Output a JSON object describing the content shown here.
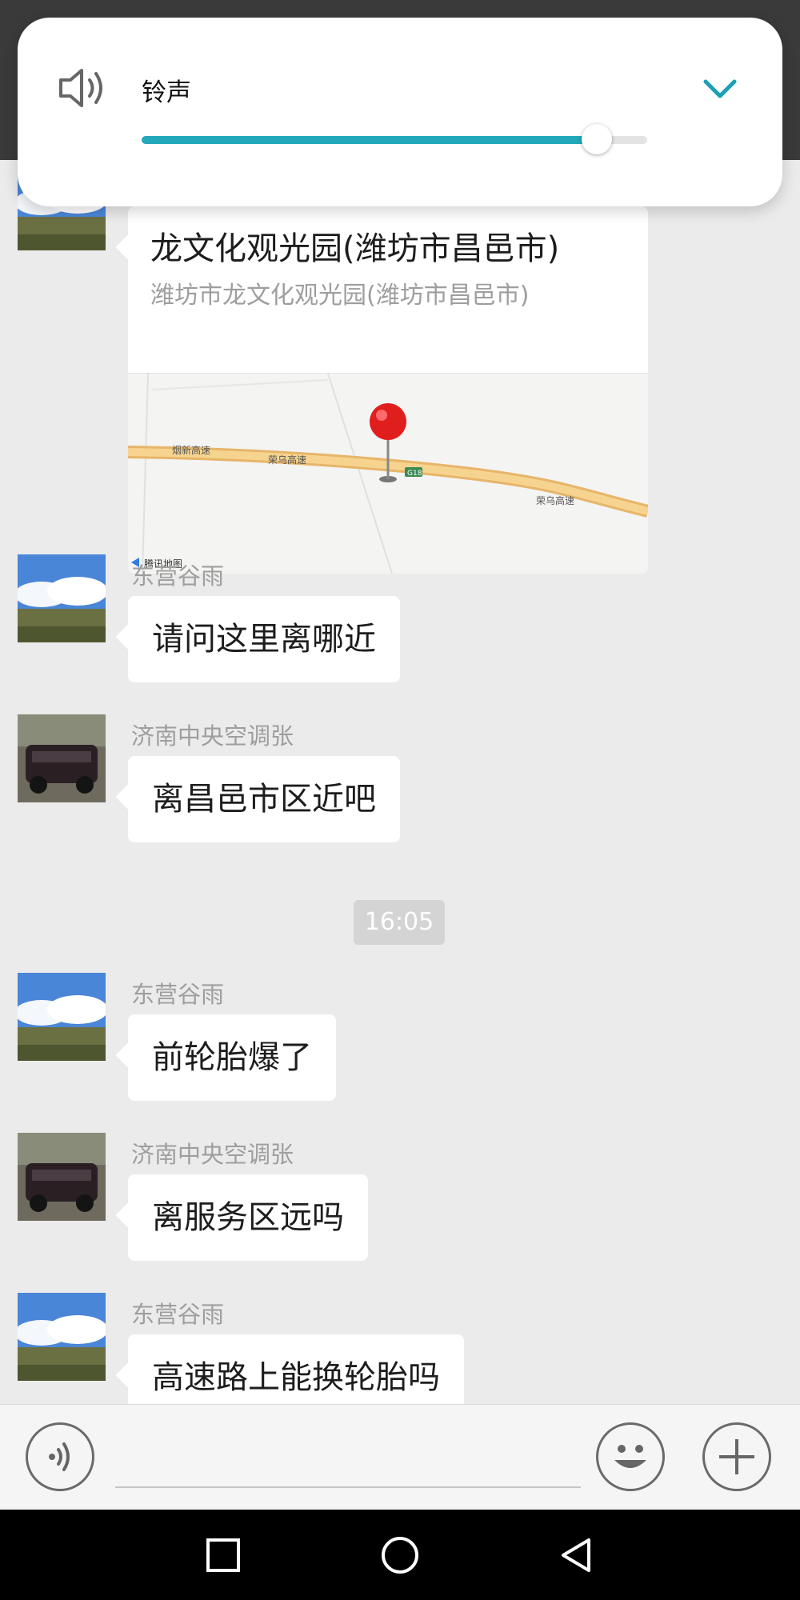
{
  "volume_popup": {
    "label": "铃声",
    "level": 0.9,
    "accent_color": "#22a8b8",
    "icons": {
      "speaker": "speaker-icon",
      "collapse": "chevron-down-icon"
    }
  },
  "location_message": {
    "title": "龙文化观光园(潍坊市昌邑市)",
    "address": "潍坊市龙文化观光园(潍坊市昌邑市)",
    "map": {
      "road_label_1": "烟新高速",
      "road_label_2": "荣乌高速",
      "road_label_3": "荣乌高速",
      "highway_shield": "G18",
      "provider": "腾讯地图"
    }
  },
  "timestamp": "16:05",
  "messages": [
    {
      "sender": "东营谷雨",
      "text": "请问这里离哪近"
    },
    {
      "sender": "济南中央空调张",
      "text": "离昌邑市区近吧"
    },
    {
      "sender": "东营谷雨",
      "text": "前轮胎爆了"
    },
    {
      "sender": "济南中央空调张",
      "text": "离服务区远吗"
    },
    {
      "sender": "东营谷雨",
      "text": "高速路上能换轮胎吗"
    }
  ],
  "input_bar": {
    "placeholder": "",
    "icons": [
      "voice-input-icon",
      "emoji-icon",
      "plus-icon"
    ]
  },
  "nav_bar": {
    "icons": [
      "recent-apps-icon",
      "home-icon",
      "back-icon"
    ]
  }
}
